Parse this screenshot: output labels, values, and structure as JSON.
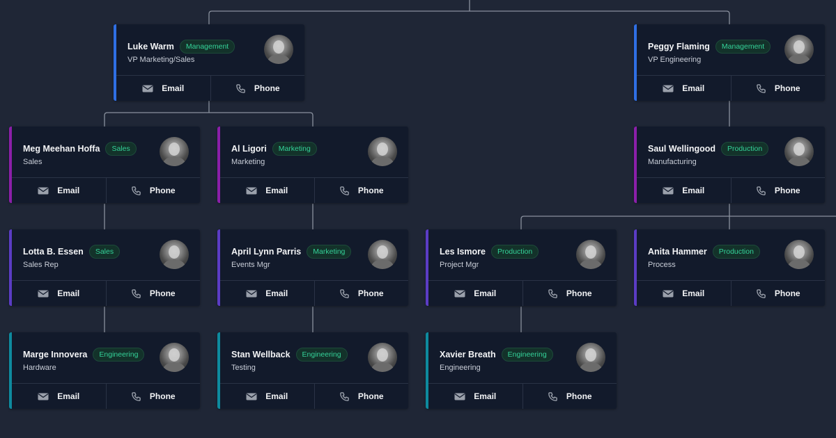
{
  "colors": {
    "background": "#1f2636",
    "card": "#121a2b",
    "connector": "#8a919e",
    "badge_text": "#34d399",
    "accent_management": "#2f6fe4",
    "accent_sales_marketing": "#8b1fa9",
    "accent_second_level": "#5b3cc4",
    "accent_engineering": "#0e8a9e"
  },
  "action_labels": {
    "email": "Email",
    "phone": "Phone"
  },
  "icons": {
    "email": "email-icon",
    "phone": "phone-icon"
  },
  "nodes": [
    {
      "id": "luke",
      "name": "Luke Warm",
      "badge": "Management",
      "title": "VP Marketing/Sales",
      "accent": "#2f6fe4"
    },
    {
      "id": "peggy",
      "name": "Peggy Flaming",
      "badge": "Management",
      "title": "VP Engineering",
      "accent": "#2f6fe4"
    },
    {
      "id": "meg",
      "name": "Meg Meehan Hoffa",
      "badge": "Sales",
      "title": "Sales",
      "accent": "#8b1fa9"
    },
    {
      "id": "al",
      "name": "Al Ligori",
      "badge": "Marketing",
      "title": "Marketing",
      "accent": "#8b1fa9"
    },
    {
      "id": "saul",
      "name": "Saul Wellingood",
      "badge": "Production",
      "title": "Manufacturing",
      "accent": "#8b1fa9"
    },
    {
      "id": "lotta",
      "name": "Lotta B. Essen",
      "badge": "Sales",
      "title": "Sales Rep",
      "accent": "#5b3cc4"
    },
    {
      "id": "april",
      "name": "April Lynn Parris",
      "badge": "Marketing",
      "title": "Events Mgr",
      "accent": "#5b3cc4"
    },
    {
      "id": "les",
      "name": "Les Ismore",
      "badge": "Production",
      "title": "Project Mgr",
      "accent": "#5b3cc4"
    },
    {
      "id": "anita",
      "name": "Anita Hammer",
      "badge": "Production",
      "title": "Process",
      "accent": "#5b3cc4"
    },
    {
      "id": "marge",
      "name": "Marge Innovera",
      "badge": "Engineering",
      "title": "Hardware",
      "accent": "#0e8a9e"
    },
    {
      "id": "stan",
      "name": "Stan Wellback",
      "badge": "Engineering",
      "title": "Testing",
      "accent": "#0e8a9e"
    },
    {
      "id": "xavier",
      "name": "Xavier Breath",
      "badge": "Engineering",
      "title": "Engineering",
      "accent": "#0e8a9e"
    }
  ]
}
